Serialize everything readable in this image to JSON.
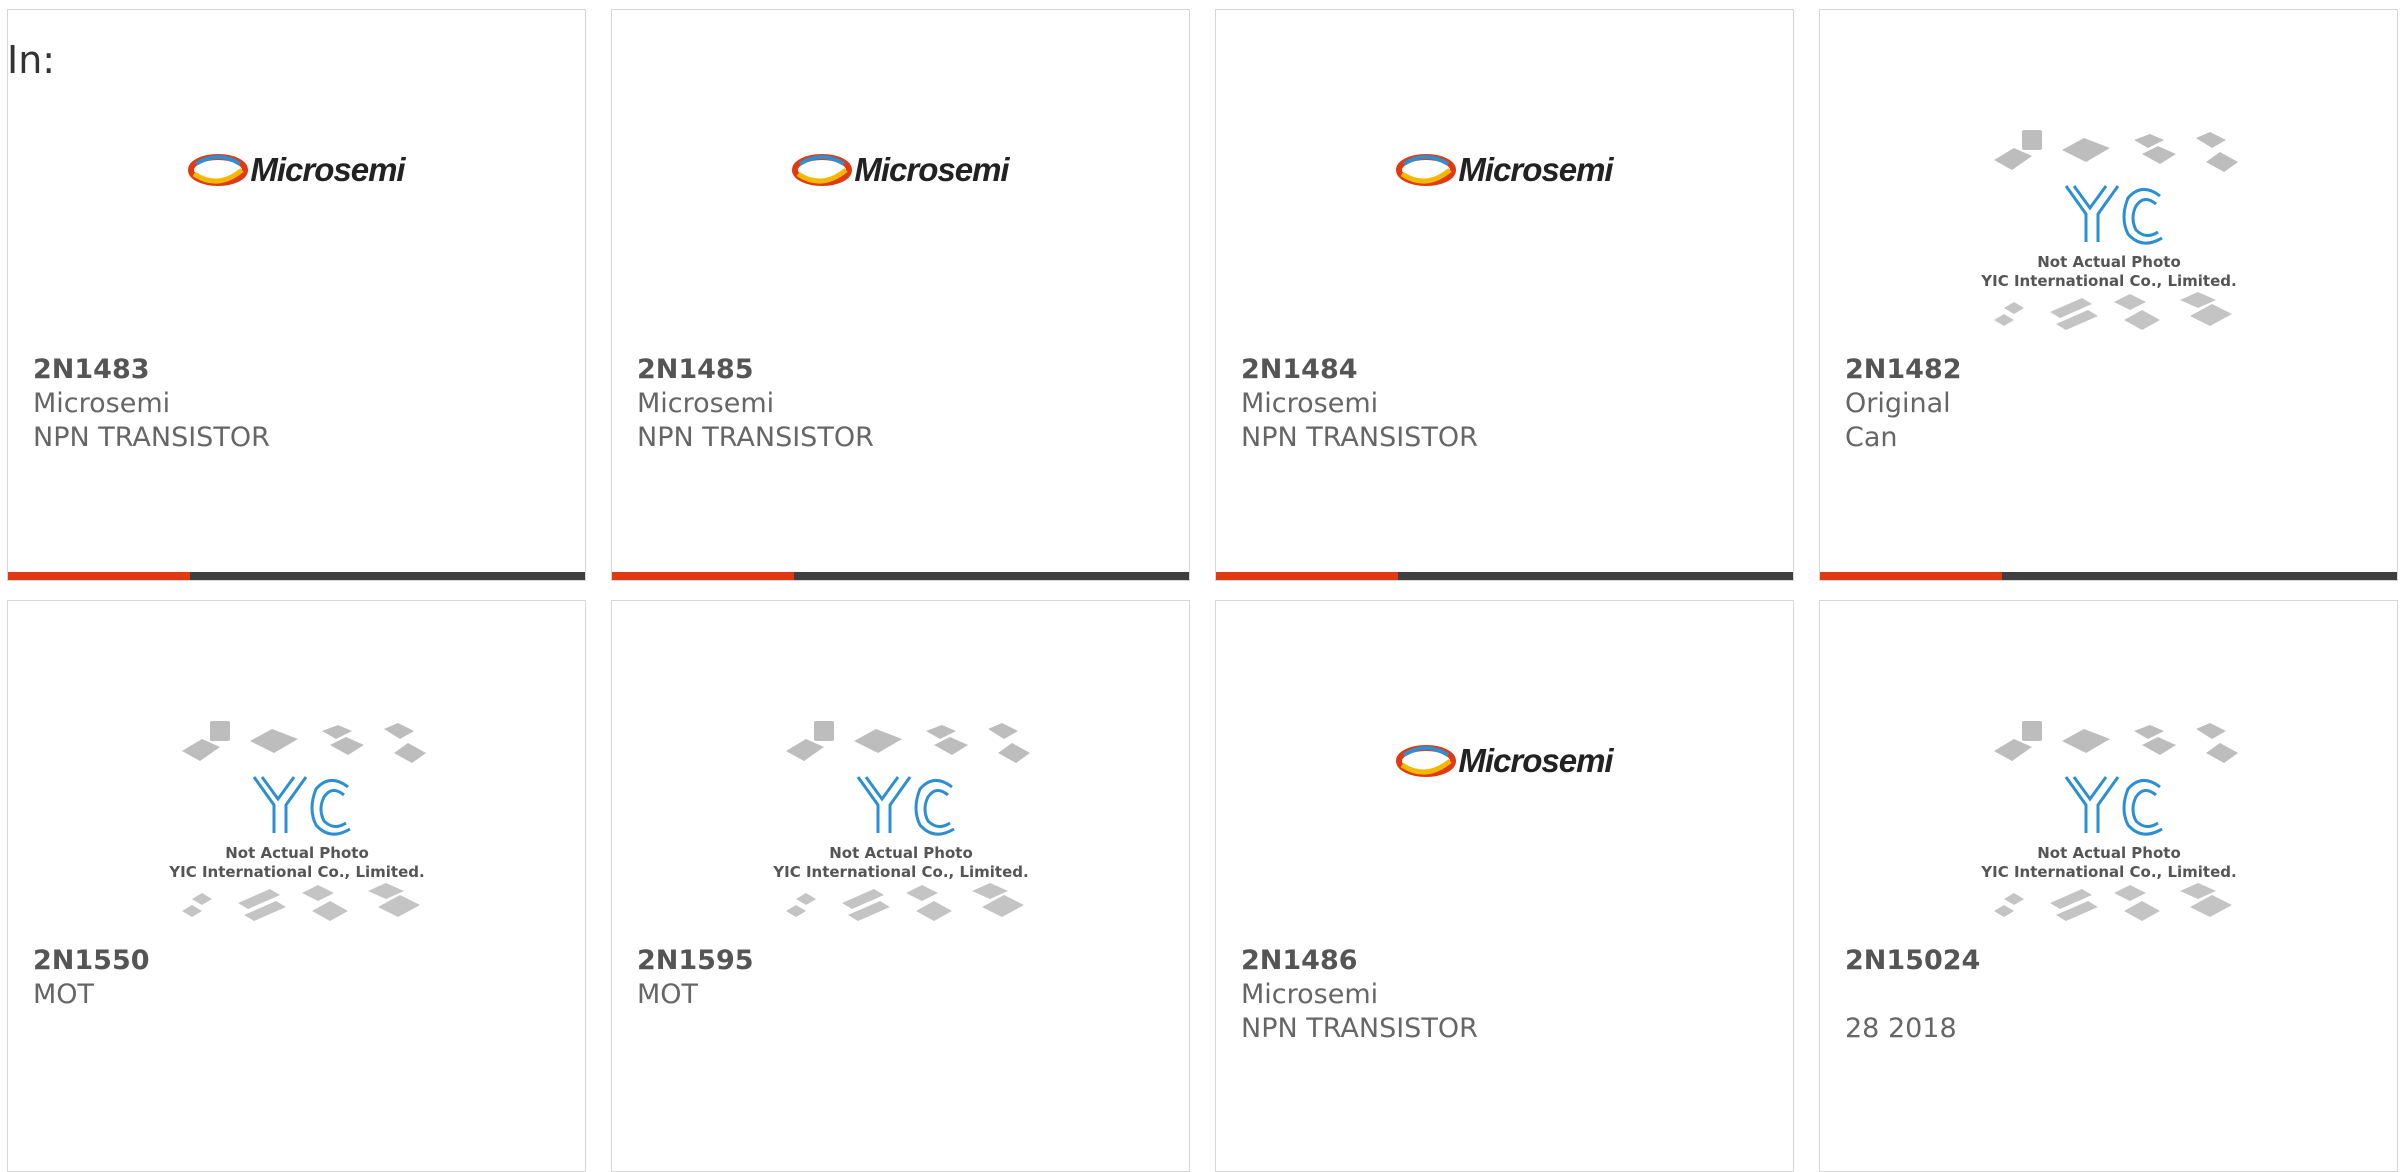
{
  "page": {
    "title": "In:"
  },
  "colors": {
    "accent": "#e03a12",
    "bar": "#3f3f3f",
    "border": "#d6d6d6",
    "text": "#666666",
    "yic_blue": "#2c8fd1"
  },
  "cards": [
    {
      "pn": "2N1483",
      "line1": "Microsemi",
      "line2": "NPN TRANSISTOR",
      "image": "microsemi-logo",
      "logo_text": "Microsemi"
    },
    {
      "pn": "2N1485",
      "line1": "Microsemi",
      "line2": "NPN TRANSISTOR",
      "image": "microsemi-logo",
      "logo_text": "Microsemi"
    },
    {
      "pn": "2N1484",
      "line1": "Microsemi",
      "line2": "NPN TRANSISTOR",
      "image": "microsemi-logo",
      "logo_text": "Microsemi"
    },
    {
      "pn": "2N1482",
      "line1": "Original",
      "line2": "Can",
      "image": "yic-placeholder",
      "photo_note": "Not Actual Photo",
      "company": "YIC International Co., Limited."
    },
    {
      "pn": "2N1550",
      "line1": "MOT",
      "line2": "",
      "image": "yic-placeholder",
      "photo_note": "Not Actual Photo",
      "company": "YIC International Co., Limited."
    },
    {
      "pn": "2N1595",
      "line1": "MOT",
      "line2": "",
      "image": "yic-placeholder",
      "photo_note": "Not Actual Photo",
      "company": "YIC International Co., Limited."
    },
    {
      "pn": "2N1486",
      "line1": "Microsemi",
      "line2": "NPN TRANSISTOR",
      "image": "microsemi-logo",
      "logo_text": "Microsemi"
    },
    {
      "pn": "2N15024",
      "line1": "",
      "line2": "28 2018",
      "image": "yic-placeholder",
      "photo_note": "Not Actual Photo",
      "company": "YIC International Co., Limited."
    }
  ]
}
